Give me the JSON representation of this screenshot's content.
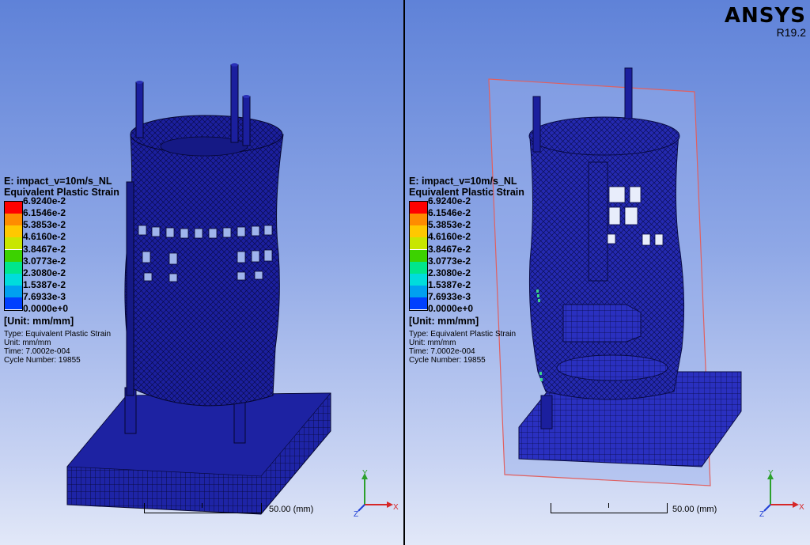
{
  "product": {
    "name": "ANSYS",
    "version": "R19.2"
  },
  "left_view": {
    "legend": {
      "title": "E: impact_v=10m/s_NL",
      "subtitle": "Equivalent Plastic Strain",
      "labels": [
        "6.9240e-2",
        "6.1546e-2",
        "5.3853e-2",
        "4.6160e-2",
        "3.8467e-2",
        "3.0773e-2",
        "2.3080e-2",
        "1.5387e-2",
        "7.6933e-3",
        "0.0000e+0"
      ],
      "unit": "[Unit: mm/mm]",
      "type": "Type: Equivalent Plastic Strain",
      "unit_line": "Unit: mm/mm",
      "time": "Time: 7.0002e-004",
      "cycle": "Cycle Number: 19855"
    },
    "scale_label": "50.00  (mm)"
  },
  "right_view": {
    "legend": {
      "title": "E: impact_v=10m/s_NL",
      "subtitle": "Equivalent Plastic Strain",
      "labels": [
        "6.9240e-2",
        "6.1546e-2",
        "5.3853e-2",
        "4.6160e-2",
        "3.8467e-2",
        "3.0773e-2",
        "2.3080e-2",
        "1.5387e-2",
        "7.6933e-3",
        "0.0000e+0"
      ],
      "unit": "[Unit: mm/mm]",
      "type": "Type: Equivalent Plastic Strain",
      "unit_line": "Unit: mm/mm",
      "time": "Time: 7.0002e-004",
      "cycle": "Cycle Number: 19855"
    },
    "scale_label": "50.00  (mm)"
  },
  "legend_colors": [
    "#ff0000",
    "#ff8c00",
    "#ffc800",
    "#c8e600",
    "#3cd200",
    "#00e68c",
    "#00dcdc",
    "#00a0f0",
    "#0040ff",
    "#0000c8"
  ],
  "axes": {
    "x": "X",
    "y": "Y",
    "z": "Z"
  },
  "colors": {
    "mesh": "#1b1f9e",
    "section_plane": "#e06060",
    "background_top": "#5f82d8"
  }
}
